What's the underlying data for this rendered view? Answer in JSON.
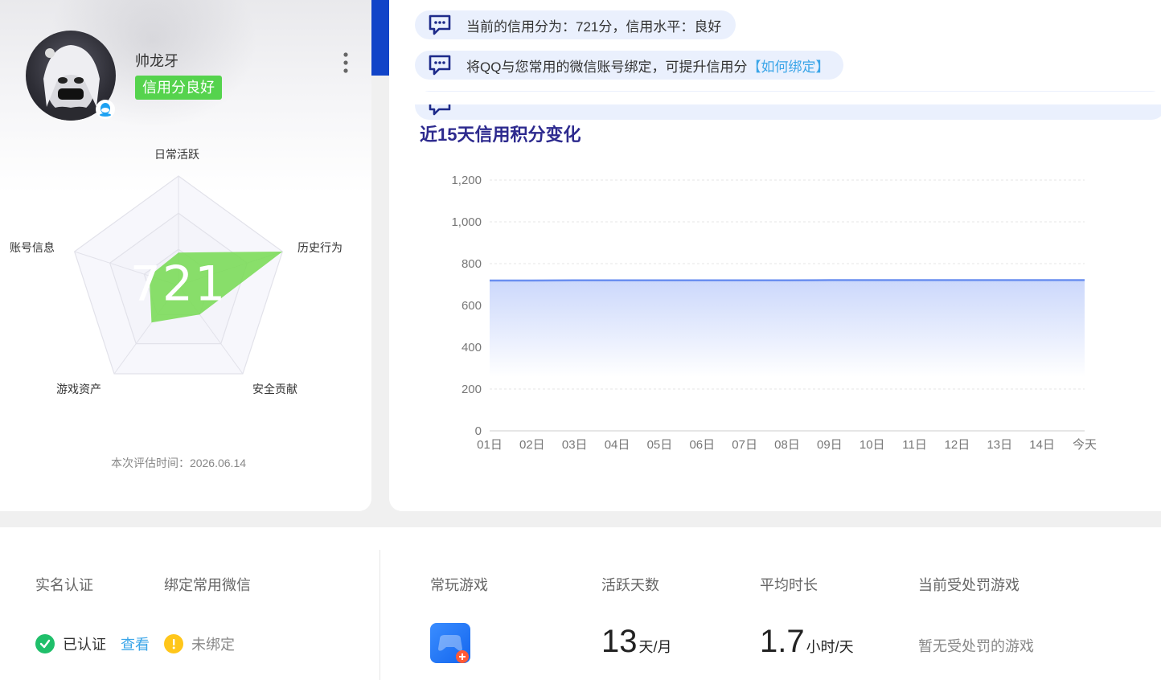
{
  "profile": {
    "username": "帅龙牙",
    "credit_badge": "信用分良好",
    "score": "721",
    "eval_time_label": "本次评估时间：",
    "eval_time": "2026.06.14"
  },
  "radar": {
    "axes": [
      "日常活跃",
      "历史行为",
      "安全贡献",
      "游戏资产",
      "账号信息"
    ],
    "values": [
      0.3,
      1.0,
      0.33,
      0.42,
      0.28
    ],
    "fill_color": "#7cdc5a"
  },
  "notices": [
    {
      "text": "当前的信用分为：721分，信用水平：良好",
      "link": ""
    },
    {
      "text": "将QQ与您常用的微信账号绑定，可提升信用分",
      "link": "【如何绑定】"
    }
  ],
  "chart_title": "近15天信用积分变化",
  "chart_data": {
    "type": "area",
    "title": "近15天信用积分变化",
    "categories": [
      "01日",
      "02日",
      "03日",
      "04日",
      "05日",
      "06日",
      "07日",
      "08日",
      "09日",
      "10日",
      "11日",
      "12日",
      "13日",
      "14日",
      "今天"
    ],
    "series": [
      {
        "values": [
          719,
          719,
          720,
          720,
          720,
          720,
          720,
          720,
          721,
          721,
          721,
          721,
          721,
          721,
          721
        ]
      }
    ],
    "yticks": [
      "0",
      "200",
      "400",
      "600",
      "800",
      "1,000",
      "1,200"
    ],
    "ylim": [
      0,
      1200
    ],
    "grid": true,
    "line_color": "#6b8ff0"
  },
  "bottom": {
    "realname_label": "实名认证",
    "realname_status": "已认证",
    "realname_link": "查看",
    "wechat_label": "绑定常用微信",
    "wechat_status": "未绑定",
    "games_label": "常玩游戏",
    "active_days_label": "活跃天数",
    "active_days_value": "13",
    "active_days_unit": "天/月",
    "avg_time_label": "平均时长",
    "avg_time_value": "1.7",
    "avg_time_unit": "小时/天",
    "punish_label": "当前受处罚游戏",
    "punish_value": "暂无受处罚的游戏"
  },
  "icons": {
    "check": "check-circle-icon",
    "warning": "warning-circle-icon",
    "message": "message-icon",
    "more": "more-vertical-icon",
    "qq": "qq-icon"
  }
}
